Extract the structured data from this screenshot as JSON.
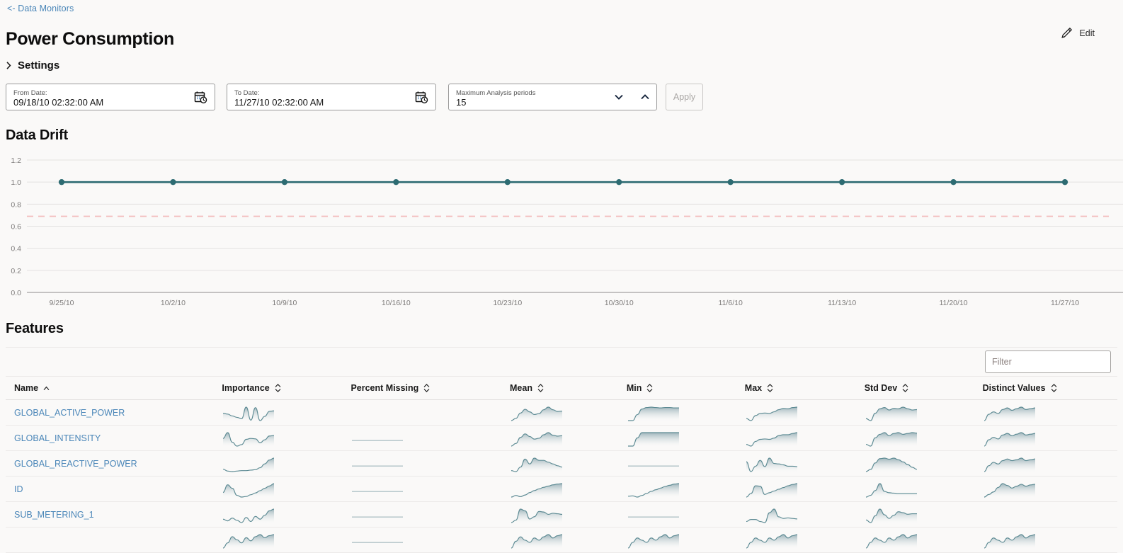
{
  "colors": {
    "background": "#faf9f8",
    "link": "#4a86b8",
    "drift_line": "#2d6b72",
    "threshold_line": "#f3bdbd",
    "spark_line": "#5c8a93",
    "grid": "#e4e2e1"
  },
  "breadcrumb": {
    "label": "<- Data Monitors",
    "icon": "back-arrow-icon"
  },
  "header": {
    "title": "Power Consumption",
    "edit_label": "Edit",
    "edit_icon": "pencil-icon"
  },
  "settings": {
    "label": "Settings",
    "expanded": false,
    "chevron_icon": "chevron-right-icon"
  },
  "filters": {
    "from_date": {
      "label": "From Date:",
      "value": "09/18/10 02:32:00 AM",
      "icon": "calendar-clock-icon"
    },
    "to_date": {
      "label": "To Date:",
      "value": "11/27/10 02:32:00 AM",
      "icon": "calendar-clock-icon"
    },
    "periods": {
      "label": "Maximum Analysis periods",
      "value": "15",
      "down_icon": "chevron-down-icon",
      "up_icon": "chevron-up-icon"
    },
    "apply_label": "Apply",
    "apply_enabled": false
  },
  "drift": {
    "title": "Data Drift"
  },
  "chart_data": {
    "type": "line",
    "title": "Data Drift",
    "xlabel": "",
    "ylabel": "",
    "ylim": [
      0.0,
      1.2
    ],
    "yticks": [
      "0.0",
      "0.2",
      "0.4",
      "0.6",
      "0.8",
      "1.0",
      "1.2"
    ],
    "ytick_values": [
      0.0,
      0.2,
      0.4,
      0.6,
      0.8,
      1.0,
      1.2
    ],
    "grid": true,
    "legend": "none",
    "x": [
      "9/25/10",
      "10/2/10",
      "10/9/10",
      "10/16/10",
      "10/23/10",
      "10/30/10",
      "11/6/10",
      "11/13/10",
      "11/20/10",
      "11/27/10"
    ],
    "series": [
      {
        "name": "Drift",
        "color": "#2d6b72",
        "markers": true,
        "values": [
          1.0,
          1.0,
          1.0,
          1.0,
          1.0,
          1.0,
          1.0,
          1.0,
          1.0,
          1.0
        ]
      }
    ],
    "annotations": [
      {
        "type": "hline",
        "name": "threshold",
        "value": 0.69,
        "style": "dashed",
        "color": "#f3bdbd"
      }
    ]
  },
  "features": {
    "title": "Features",
    "filter_placeholder": "Filter",
    "filter_value": "",
    "columns": [
      {
        "key": "name",
        "label": "Name",
        "sort": "asc"
      },
      {
        "key": "imp",
        "label": "Importance",
        "sort": "none"
      },
      {
        "key": "pm",
        "label": "Percent Missing",
        "sort": "none"
      },
      {
        "key": "mean",
        "label": "Mean",
        "sort": "none"
      },
      {
        "key": "min",
        "label": "Min",
        "sort": "none"
      },
      {
        "key": "max",
        "label": "Max",
        "sort": "none"
      },
      {
        "key": "std",
        "label": "Std Dev",
        "sort": "none"
      },
      {
        "key": "distinct",
        "label": "Distinct Values",
        "sort": "none"
      }
    ],
    "rows": [
      {
        "name": "GLOBAL_ACTIVE_POWER",
        "sparklines": {
          "imp": [
            0.62,
            0.58,
            0.5,
            0.44,
            0.38,
            0.88,
            0.32,
            0.86,
            0.3,
            0.48,
            0.7,
            0.72
          ],
          "pm": null,
          "mean": [
            0.2,
            0.3,
            0.55,
            0.72,
            0.6,
            0.48,
            0.52,
            0.7,
            0.82,
            0.7,
            0.62,
            0.64
          ],
          "min": [
            0.1,
            0.1,
            0.42,
            0.72,
            0.8,
            0.82,
            0.8,
            0.78,
            0.8,
            0.8,
            0.78,
            0.78
          ],
          "max": [
            0.16,
            0.06,
            0.3,
            0.4,
            0.42,
            0.4,
            0.48,
            0.58,
            0.64,
            0.62,
            0.68,
            0.7
          ],
          "std": [
            0.18,
            0.08,
            0.44,
            0.66,
            0.72,
            0.6,
            0.68,
            0.66,
            0.74,
            0.66,
            0.6,
            0.62
          ],
          "distinct": [
            0.3,
            0.46,
            0.52,
            0.48,
            0.58,
            0.62,
            0.56,
            0.6,
            0.64,
            0.58,
            0.6,
            0.62
          ]
        }
      },
      {
        "name": "GLOBAL_INTENSITY",
        "sparklines": {
          "imp": [
            0.56,
            0.8,
            0.4,
            0.24,
            0.3,
            0.52,
            0.56,
            0.54,
            0.38,
            0.5,
            0.66,
            0.68
          ],
          "pm": [
            0.0,
            0.0,
            0.0,
            0.0,
            0.0,
            0.0,
            0.0,
            0.0,
            0.0,
            0.0,
            0.0,
            0.0
          ],
          "mean": [
            0.18,
            0.3,
            0.58,
            0.74,
            0.62,
            0.5,
            0.54,
            0.7,
            0.8,
            0.68,
            0.64,
            0.66
          ],
          "min": [
            0.1,
            0.1,
            0.56,
            0.86,
            0.86,
            0.86,
            0.86,
            0.86,
            0.86,
            0.86,
            0.86,
            0.86
          ],
          "max": [
            0.14,
            0.06,
            0.28,
            0.38,
            0.4,
            0.38,
            0.44,
            0.56,
            0.6,
            0.6,
            0.66,
            0.7
          ],
          "std": [
            0.16,
            0.08,
            0.46,
            0.62,
            0.7,
            0.56,
            0.66,
            0.7,
            0.62,
            0.66,
            0.7,
            0.68
          ],
          "distinct": [
            0.28,
            0.44,
            0.5,
            0.46,
            0.56,
            0.6,
            0.54,
            0.58,
            0.62,
            0.56,
            0.58,
            0.6
          ]
        }
      },
      {
        "name": "GLOBAL_REACTIVE_POWER",
        "sparklines": {
          "imp": [
            0.24,
            0.16,
            0.14,
            0.16,
            0.18,
            0.18,
            0.2,
            0.22,
            0.3,
            0.46,
            0.62,
            0.7
          ],
          "pm": [
            0.0,
            0.0,
            0.0,
            0.0,
            0.0,
            0.0,
            0.0,
            0.0,
            0.0,
            0.0,
            0.0,
            0.0
          ],
          "mean": [
            0.14,
            0.1,
            0.3,
            0.66,
            0.44,
            0.7,
            0.6,
            0.6,
            0.52,
            0.44,
            0.36,
            0.3
          ],
          "min": [
            0.02,
            0.02,
            0.02,
            0.02,
            0.02,
            0.02,
            0.02,
            0.02,
            0.02,
            0.02,
            0.02,
            0.02
          ],
          "max": [
            0.54,
            0.1,
            0.34,
            0.6,
            0.32,
            0.7,
            0.46,
            0.44,
            0.4,
            0.34,
            0.34,
            0.32
          ],
          "std": [
            0.12,
            0.2,
            0.44,
            0.6,
            0.62,
            0.58,
            0.62,
            0.56,
            0.48,
            0.38,
            0.28,
            0.2
          ],
          "distinct": [
            0.26,
            0.4,
            0.48,
            0.44,
            0.52,
            0.56,
            0.52,
            0.54,
            0.58,
            0.52,
            0.54,
            0.56
          ]
        }
      },
      {
        "name": "ID",
        "sparklines": {
          "imp": [
            0.36,
            0.62,
            0.5,
            0.26,
            0.2,
            0.22,
            0.28,
            0.34,
            0.42,
            0.5,
            0.58,
            0.66
          ],
          "pm": [
            0.0,
            0.0,
            0.0,
            0.0,
            0.0,
            0.0,
            0.0,
            0.0,
            0.0,
            0.0,
            0.0,
            0.0
          ],
          "mean": [
            0.22,
            0.3,
            0.24,
            0.32,
            0.44,
            0.54,
            0.62,
            0.7,
            0.76,
            0.82,
            0.86,
            0.88
          ],
          "min": [
            0.18,
            0.2,
            0.14,
            0.22,
            0.32,
            0.42,
            0.5,
            0.58,
            0.66,
            0.72,
            0.78,
            0.8
          ],
          "max": [
            0.18,
            0.34,
            0.7,
            0.68,
            0.3,
            0.38,
            0.46,
            0.54,
            0.62,
            0.7,
            0.76,
            0.8
          ],
          "std": [
            0.14,
            0.22,
            0.44,
            0.76,
            0.4,
            0.34,
            0.32,
            0.3,
            0.3,
            0.3,
            0.3,
            0.3
          ],
          "distinct": [
            0.18,
            0.26,
            0.34,
            0.48,
            0.6,
            0.54,
            0.46,
            0.52,
            0.58,
            0.52,
            0.56,
            0.58
          ]
        }
      },
      {
        "name": "SUB_METERING_1",
        "sparklines": {
          "imp": [
            0.3,
            0.24,
            0.34,
            0.26,
            0.18,
            0.36,
            0.22,
            0.4,
            0.3,
            0.44,
            0.6,
            0.66
          ],
          "pm": [
            0.0,
            0.0,
            0.0,
            0.0,
            0.0,
            0.0,
            0.0,
            0.0,
            0.0,
            0.0,
            0.0,
            0.0
          ],
          "mean": [
            0.1,
            0.18,
            0.56,
            0.5,
            0.22,
            0.3,
            0.48,
            0.46,
            0.38,
            0.42,
            0.4,
            0.38
          ],
          "min": [
            0.02,
            0.02,
            0.02,
            0.02,
            0.02,
            0.02,
            0.02,
            0.02,
            0.02,
            0.02,
            0.02,
            0.02
          ],
          "max": [
            0.22,
            0.3,
            0.3,
            0.22,
            0.18,
            0.56,
            0.7,
            0.4,
            0.34,
            0.36,
            0.34,
            0.32
          ],
          "std": [
            0.2,
            0.1,
            0.36,
            0.62,
            0.4,
            0.26,
            0.38,
            0.52,
            0.48,
            0.42,
            0.44,
            0.44
          ]
        }
      },
      {
        "name": "",
        "partial": true,
        "sparklines": {
          "imp": [
            0.3,
            0.4,
            0.52,
            0.46,
            0.4,
            0.5,
            0.44,
            0.52,
            0.56,
            0.5,
            0.54,
            0.56
          ],
          "pm": [
            0.0,
            0.0,
            0.0,
            0.0,
            0.0,
            0.0,
            0.0,
            0.0,
            0.0,
            0.0,
            0.0,
            0.0
          ],
          "mean": [
            0.3,
            0.42,
            0.5,
            0.44,
            0.4,
            0.48,
            0.44,
            0.5,
            0.54,
            0.48,
            0.52,
            0.54
          ],
          "min": [
            0.28,
            0.38,
            0.46,
            0.42,
            0.38,
            0.46,
            0.42,
            0.48,
            0.52,
            0.46,
            0.5,
            0.52
          ],
          "max": [
            0.3,
            0.4,
            0.48,
            0.44,
            0.4,
            0.48,
            0.44,
            0.5,
            0.54,
            0.48,
            0.52,
            0.54
          ],
          "std": [
            0.3,
            0.4,
            0.48,
            0.44,
            0.4,
            0.48,
            0.44,
            0.5,
            0.54,
            0.48,
            0.52,
            0.54
          ],
          "distinct": [
            0.3,
            0.4,
            0.48,
            0.44,
            0.4,
            0.48,
            0.44,
            0.5,
            0.54,
            0.48,
            0.52,
            0.54
          ]
        }
      }
    ]
  }
}
